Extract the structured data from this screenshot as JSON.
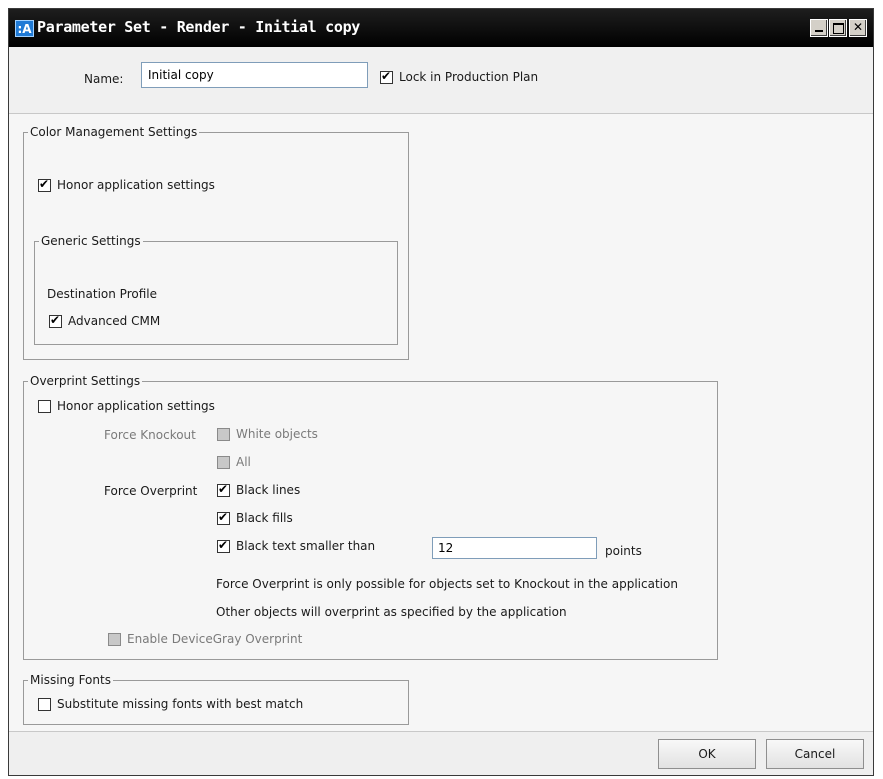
{
  "window": {
    "app_icon": ":A",
    "title": "Parameter Set - Render - Initial copy"
  },
  "header": {
    "name_label": "Name:",
    "name_value": "Initial copy",
    "lock_label": "Lock in Production Plan",
    "lock_checked": true
  },
  "color_management": {
    "title": "Color Management Settings",
    "honor_label": "Honor application settings",
    "generic": {
      "title": "Generic Settings",
      "destination_profile": "Destination Profile",
      "advanced_cmm_label": "Advanced CMM"
    }
  },
  "overprint": {
    "title": "Overprint Settings",
    "honor_label": "Honor application settings",
    "force_knockout_label": "Force Knockout",
    "white_objects_label": "White objects",
    "all_label": "All",
    "force_overprint_label": "Force Overprint",
    "black_lines_label": "Black lines",
    "black_fills_label": "Black fills",
    "black_text_label": "Black text smaller than",
    "black_text_value": "12",
    "points_label": "points",
    "note1": "Force Overprint is only possible for objects set to Knockout in the application",
    "note2": "Other objects will overprint as specified by the application",
    "devicegray_label": "Enable DeviceGray Overprint"
  },
  "missing_fonts": {
    "title": "Missing Fonts",
    "substitute_label": "Substitute missing fonts with best match"
  },
  "footer": {
    "ok_label": "OK",
    "cancel_label": "Cancel"
  }
}
